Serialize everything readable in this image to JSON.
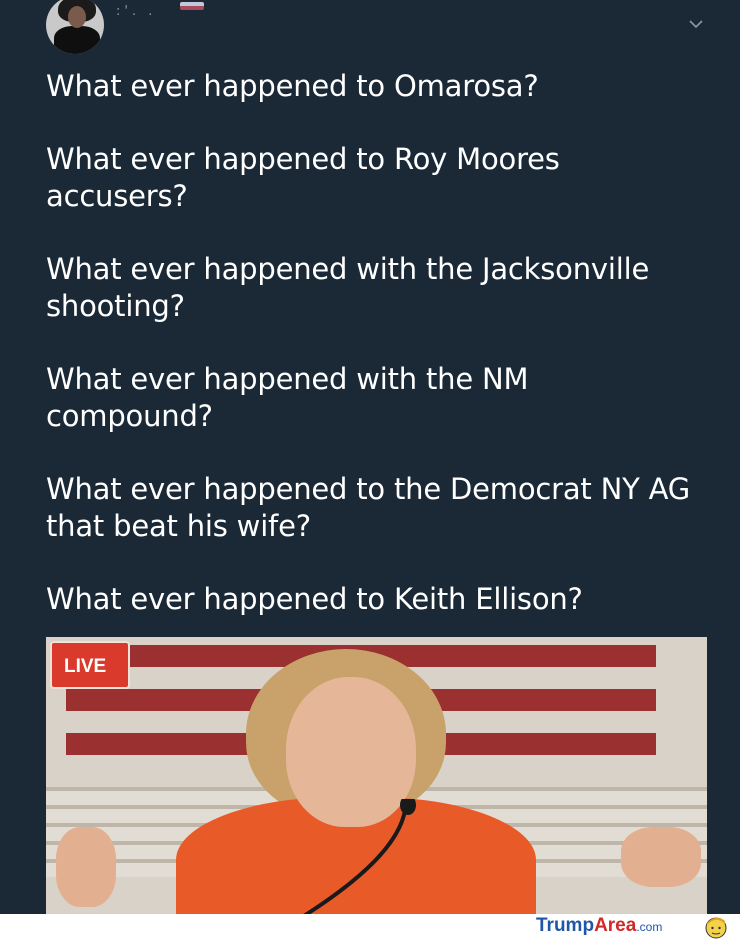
{
  "header": {
    "display_name": ":'. .",
    "flag_icon": "us-flag-icon",
    "menu_icon": "chevron-down-icon"
  },
  "tweet": {
    "paragraphs": [
      "What ever happened to Omarosa?",
      "What ever happened to Roy Moores\naccusers?",
      "What ever happened with the Jacksonville\nshooting?",
      "What ever happened with the NM\ncompound?",
      "What ever happened to the Democrat NY AG\nthat beat his wife?",
      "What ever happened to Keith Ellison?"
    ]
  },
  "media": {
    "live_label": "LIVE",
    "live_color": "#d93a2b"
  },
  "footer": {
    "brand_trump": "Trump",
    "brand_area": "Area",
    "brand_com": ".com",
    "brand_blue": "#1f56a8",
    "brand_red": "#cf2a2a"
  },
  "colors": {
    "background": "#1b2937",
    "text": "#ffffff",
    "muted": "#8899a6"
  }
}
